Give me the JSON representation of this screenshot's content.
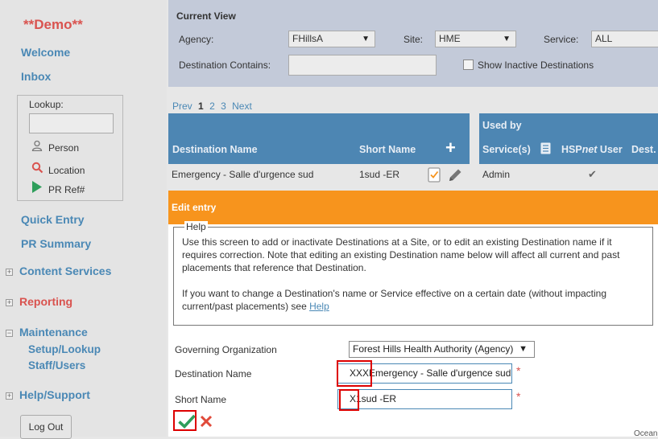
{
  "sidebar": {
    "demo": "**Demo**",
    "welcome": "Welcome",
    "inbox": "Inbox",
    "lookup": {
      "title": "Lookup:",
      "items": [
        {
          "label": "Person",
          "icon": "person-icon"
        },
        {
          "label": "Location",
          "icon": "location-search-icon"
        },
        {
          "label": "PR Ref#",
          "icon": "play-icon"
        }
      ]
    },
    "quick_entry": "Quick Entry",
    "pr_summary": "PR Summary",
    "content_services": "Content Services",
    "reporting": "Reporting",
    "maintenance": "Maintenance",
    "setup_lookup": "Setup/Lookup",
    "staff_users": "Staff/Users",
    "help_support": "Help/Support",
    "logout": "Log Out",
    "plus": "+",
    "minus": "−"
  },
  "current_view": {
    "title": "Current View",
    "agency_label": "Agency:",
    "agency_value": "FHillsA",
    "site_label": "Site:",
    "site_value": "HME",
    "service_label": "Service:",
    "service_value": "ALL",
    "dest_contains_label": "Destination Contains:",
    "dest_contains_value": "",
    "show_inactive_label": "Show Inactive Destinations",
    "show_inactive_checked": false
  },
  "pager": {
    "prev": "Prev",
    "current": "1",
    "pages": [
      "2",
      "3"
    ],
    "next": "Next"
  },
  "table": {
    "headers": {
      "dest_name": "Destination Name",
      "short_name": "Short Name",
      "add": "+",
      "used_by": "Used by",
      "services": "Service(s)",
      "hspnet_pre": "HSP",
      "hspnet_it": "net",
      "hspnet_post": " User",
      "dest": "Dest."
    },
    "rows": [
      {
        "dest_name": "Emergency - Salle d'urgence sud",
        "short_name": "1sud -ER",
        "service": "Admin",
        "hspnet_user": "✔"
      }
    ]
  },
  "edit": {
    "title": "Edit entry",
    "help_legend": "Help",
    "help_p1": "Use this screen to add or inactivate Destinations at a Site, or to edit an existing Destination name if it requires correction.  Note that editing an existing Destination name below will affect all current and past placements that reference that Destination.",
    "help_p2": "If you want to change a Destination's name or Service effective on a certain date (without impacting current/past placements) see ",
    "help_link": "Help",
    "gov_org_label": "Governing Organization",
    "gov_org_value": "Forest Hills Health Authority (Agency)",
    "dest_name_label": "Destination Name",
    "dest_name_value": "XXXEmergency - Salle d'urgence sud",
    "short_name_label": "Short Name",
    "short_name_value": "X1sud -ER",
    "required_mark": "*",
    "partial_text": "Ocean"
  },
  "colors": {
    "accent": "#4d86b3",
    "edit_bar": "#f7941d",
    "demo": "#d9534f",
    "link": "#4a88b5",
    "highlight": "#dd0000"
  }
}
